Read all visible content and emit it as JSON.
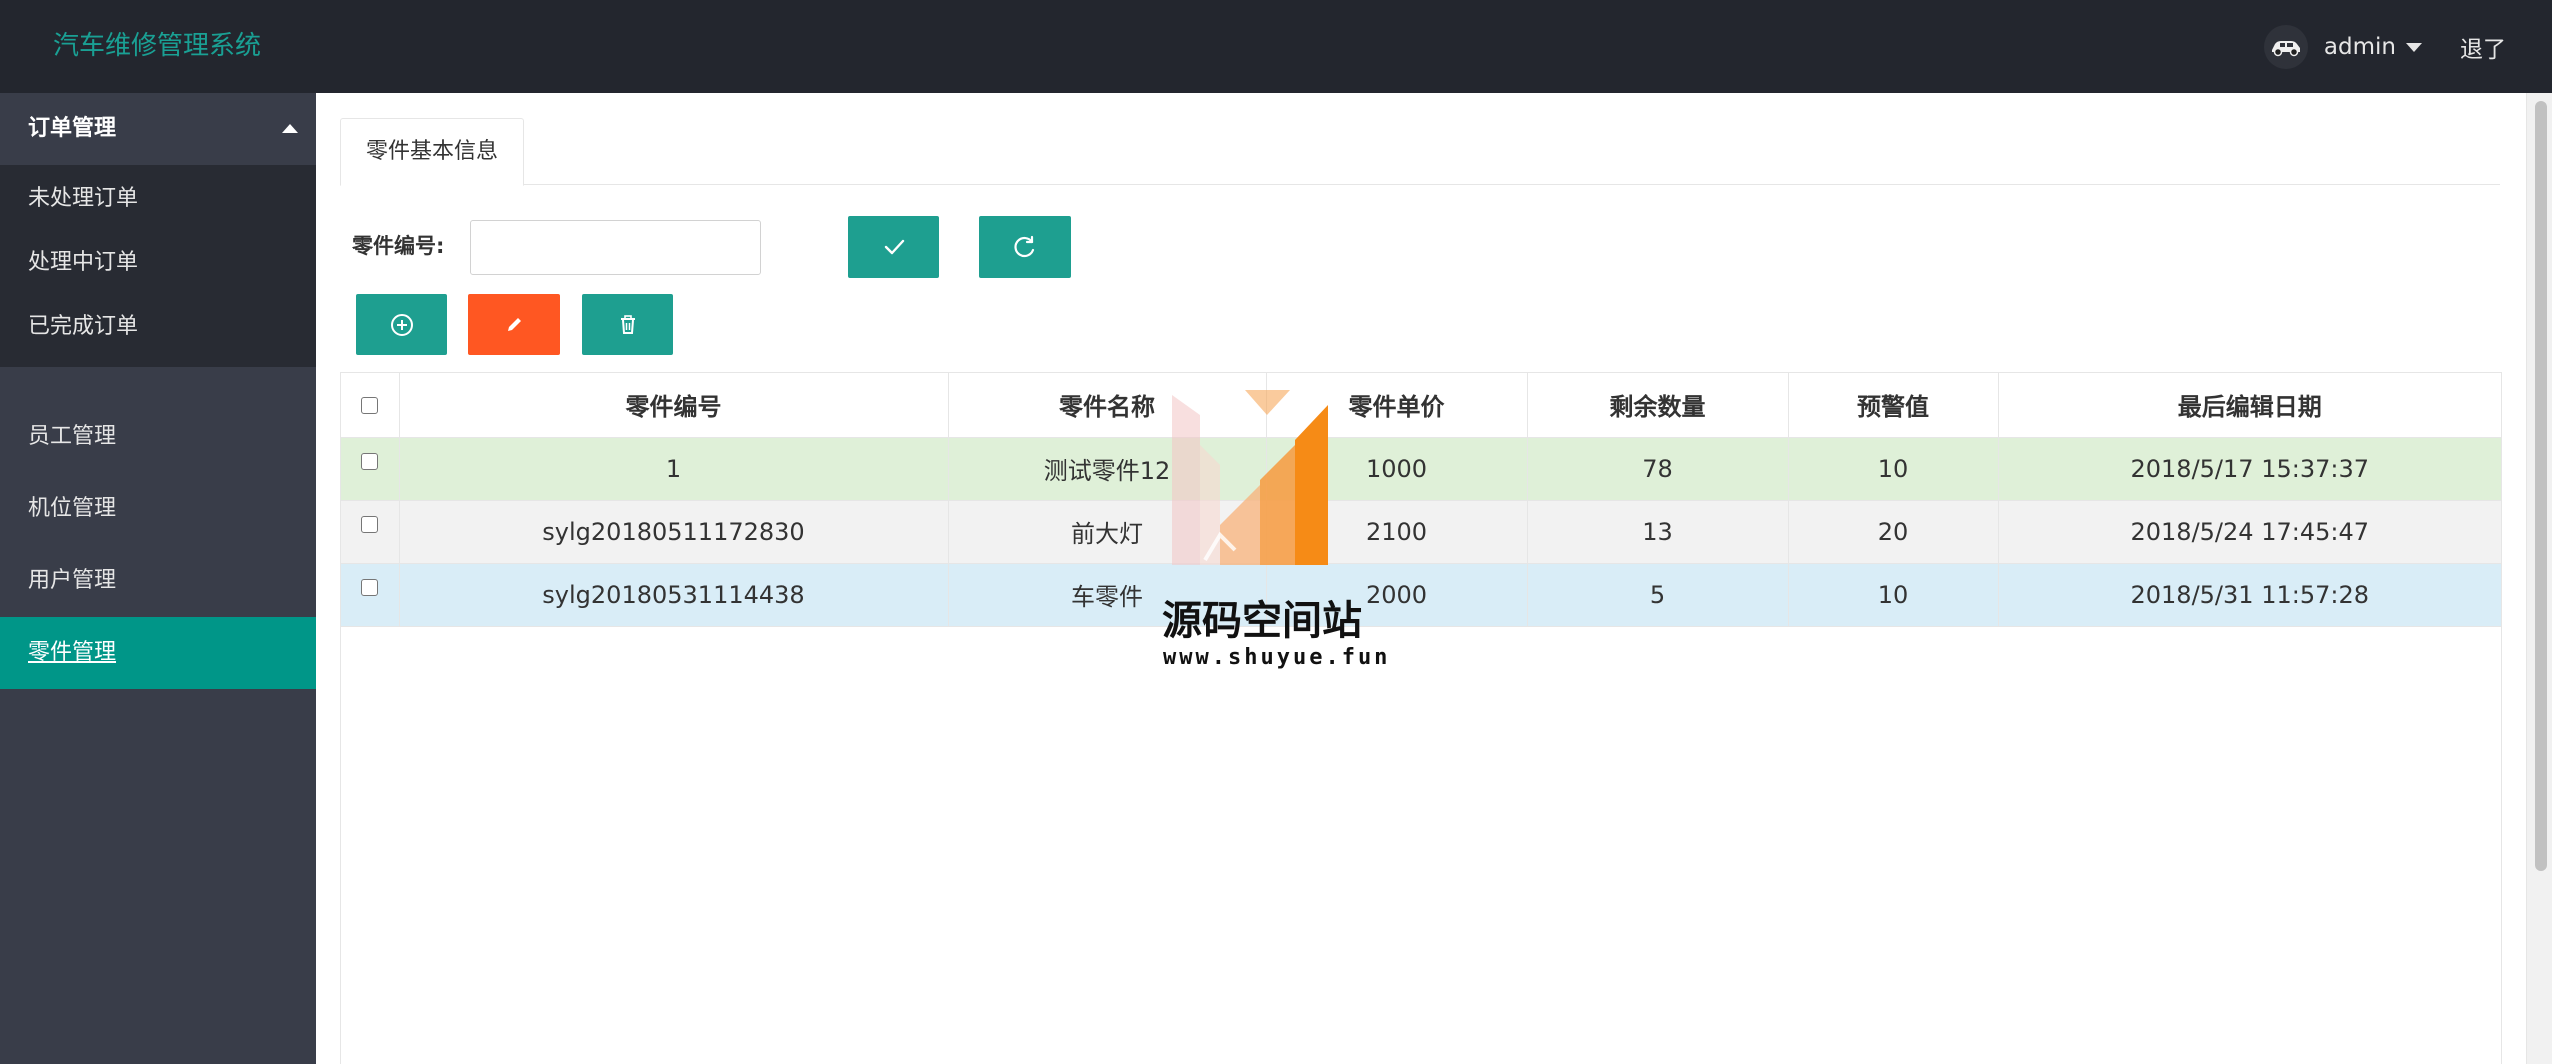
{
  "header": {
    "app_title": "汽车维修管理系统",
    "user_name": "admin",
    "logout_label": "退了"
  },
  "sidebar": {
    "group_title": "订单管理",
    "order_items": [
      {
        "label": "未处理订单"
      },
      {
        "label": "处理中订单"
      },
      {
        "label": "已完成订单"
      }
    ],
    "nav_items": [
      {
        "label": "员工管理"
      },
      {
        "label": "机位管理"
      },
      {
        "label": "用户管理"
      },
      {
        "label": "零件管理",
        "active": true
      }
    ]
  },
  "main": {
    "tab_label": "零件基本信息",
    "search": {
      "label": "零件编号:",
      "value": "",
      "placeholder": ""
    },
    "buttons": {
      "confirm_icon": "check-icon",
      "refresh_icon": "refresh-icon",
      "add_icon": "add-circle-icon",
      "edit_icon": "pencil-icon",
      "delete_icon": "trash-icon"
    },
    "table": {
      "columns": [
        "零件编号",
        "零件名称",
        "零件单价",
        "剩余数量",
        "预警值",
        "最后编辑日期"
      ],
      "rows": [
        {
          "id": "1",
          "name": "测试零件12",
          "price": "1000",
          "remaining": "78",
          "warning": "10",
          "last_edited": "2018/5/17 15:37:37"
        },
        {
          "id": "sylg20180511172830",
          "name": "前大灯",
          "price": "2100",
          "remaining": "13",
          "warning": "20",
          "last_edited": "2018/5/24 17:45:47"
        },
        {
          "id": "sylg20180531114438",
          "name": "车零件",
          "price": "2000",
          "remaining": "5",
          "warning": "10",
          "last_edited": "2018/5/31 11:57:28"
        }
      ]
    }
  },
  "watermark": {
    "title": "源码空间站",
    "url": "www.shuyue.fun"
  },
  "colors": {
    "header_bg": "#23262e",
    "sidebar_bg": "#393d49",
    "accent": "#009688",
    "danger": "#ff5722",
    "row_success": "#dff0d8",
    "row_info": "#d9edf7"
  }
}
